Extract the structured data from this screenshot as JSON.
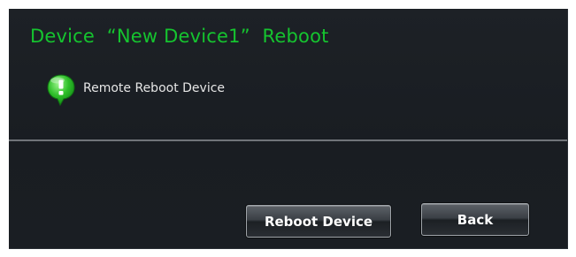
{
  "dialog": {
    "title": "Device  “New Device1”  Reboot",
    "info_icon": "green-info-bubble-icon",
    "info_text": "Remote Reboot Device",
    "buttons": {
      "reboot_label": "Reboot Device",
      "back_label": "Back"
    }
  },
  "colors": {
    "title": "#15c42f",
    "background": "#1b1f24",
    "text": "#e6e6e6"
  }
}
